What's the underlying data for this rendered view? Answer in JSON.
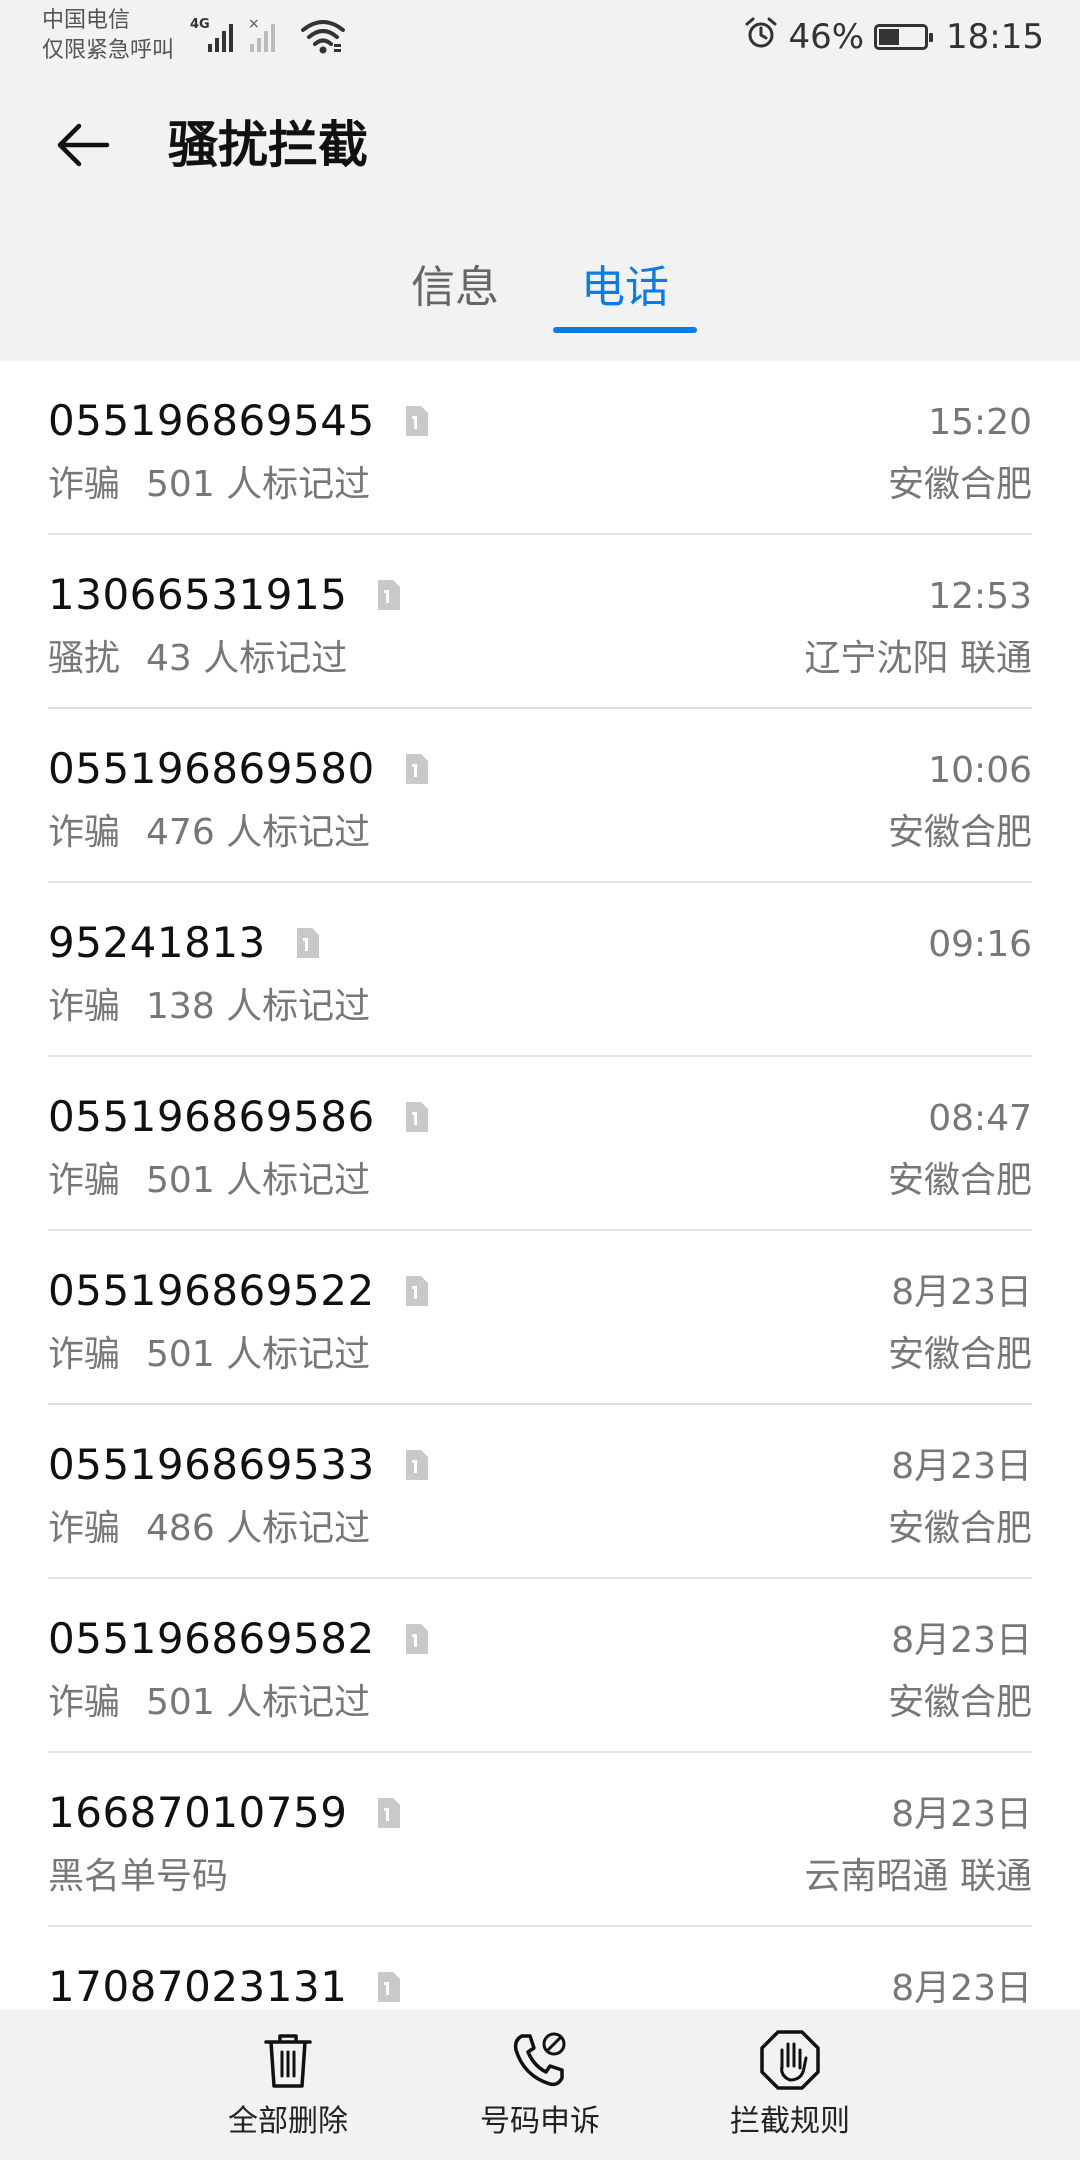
{
  "status_bar": {
    "carrier_line1": "中国电信",
    "carrier_line2": "仅限紧急呼叫",
    "network_type": "4G",
    "battery_percent": "46%",
    "battery_level": 0.46,
    "time": "18:15"
  },
  "header": {
    "title": "骚扰拦截",
    "tabs": [
      {
        "label": "信息",
        "selected": false
      },
      {
        "label": "电话",
        "selected": true
      }
    ]
  },
  "calls": [
    {
      "number": "055196869545",
      "time": "15:20",
      "tag": "诈骗",
      "marks": "501 人标记过",
      "location": "安徽合肥"
    },
    {
      "number": "13066531915",
      "time": "12:53",
      "tag": "骚扰",
      "marks": "43 人标记过",
      "location": "辽宁沈阳 联通"
    },
    {
      "number": "055196869580",
      "time": "10:06",
      "tag": "诈骗",
      "marks": "476 人标记过",
      "location": "安徽合肥"
    },
    {
      "number": "95241813",
      "time": "09:16",
      "tag": "诈骗",
      "marks": "138 人标记过",
      "location": ""
    },
    {
      "number": "055196869586",
      "time": "08:47",
      "tag": "诈骗",
      "marks": "501 人标记过",
      "location": "安徽合肥"
    },
    {
      "number": "055196869522",
      "time": "8月23日",
      "tag": "诈骗",
      "marks": "501 人标记过",
      "location": "安徽合肥"
    },
    {
      "number": "055196869533",
      "time": "8月23日",
      "tag": "诈骗",
      "marks": "486 人标记过",
      "location": "安徽合肥"
    },
    {
      "number": "055196869582",
      "time": "8月23日",
      "tag": "诈骗",
      "marks": "501 人标记过",
      "location": "安徽合肥"
    },
    {
      "number": "16687010759",
      "time": "8月23日",
      "tag": "黑名单号码",
      "marks": "",
      "location": "云南昭通 联通"
    },
    {
      "number": "17087023131",
      "time": "8月23日",
      "tag": "",
      "marks": "",
      "location": ""
    }
  ],
  "bottom_bar": {
    "delete_all_label": "全部删除",
    "appeal_label": "号码申诉",
    "rules_label": "拦截规则"
  },
  "colors": {
    "accent": "#0a7ce6",
    "background": "#f2f2f2",
    "secondary_text": "#777777"
  },
  "icons": [
    "back-arrow-icon",
    "signal-icon",
    "wifi-icon",
    "alarm-icon",
    "battery-icon",
    "sim-card-icon",
    "trash-icon",
    "phone-appeal-icon",
    "block-hand-icon"
  ]
}
